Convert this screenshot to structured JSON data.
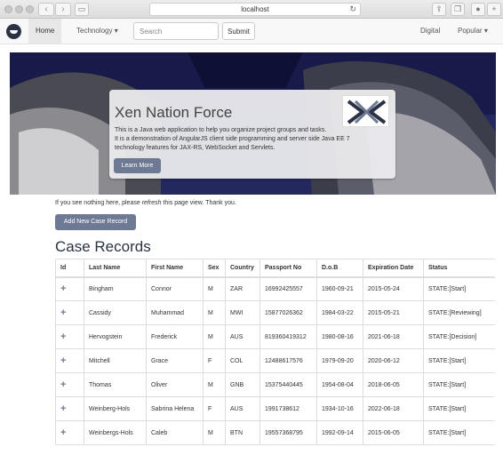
{
  "browser": {
    "url": "localhost"
  },
  "navbar": {
    "brand_icon": "owl-logo-icon",
    "home_label": "Home",
    "technology_label": "Technology",
    "search_placeholder": "Search",
    "submit_label": "Submit",
    "digital_label": "Digital",
    "popular_label": "Popular"
  },
  "hero": {
    "title": "Xen Nation Force",
    "line1": "This is a Java web application to help you organize project groups and tasks.",
    "line2": "It is a demonstration of AngularJS client side programming and server side Java EE 7",
    "line3": "technology features for JAX-RS, WebSocket and Servlets.",
    "learn_more_label": "Learn More",
    "logo_icon": "xen-x-logo-icon"
  },
  "notice": {
    "prefix": "If you see nothing here, please ",
    "emphasis": "refresh",
    "suffix": " this page view. Thank you."
  },
  "add_button_label": "Add New Case Record",
  "section_title": "Case Records",
  "table": {
    "columns": [
      "Id",
      "Last Name",
      "First Name",
      "Sex",
      "Country",
      "Passport No",
      "D.o.B",
      "Expiration Date",
      "Status"
    ],
    "rows": [
      [
        "+",
        "Bingham",
        "Connor",
        "M",
        "ZAR",
        "16992425557",
        "1960-09-21",
        "2015-05-24",
        "STATE:[Start]"
      ],
      [
        "+",
        "Cassidy",
        "Muhammad",
        "M",
        "MWI",
        "15877026362",
        "1984-03-22",
        "2015-05-21",
        "STATE:[Reviewing]"
      ],
      [
        "+",
        "Hervogstein",
        "Frederick",
        "M",
        "AUS",
        "819360419312",
        "1980-08-16",
        "2021-06-18",
        "STATE:[Decision]"
      ],
      [
        "+",
        "Mitchell",
        "Grace",
        "F",
        "COL",
        "12488617576",
        "1979-09-20",
        "2020-06-12",
        "STATE:[Start]"
      ],
      [
        "+",
        "Thomas",
        "Oliver",
        "M",
        "GNB",
        "15375440445",
        "1954-08-04",
        "2018-06-05",
        "STATE:[Start]"
      ],
      [
        "+",
        "Weinberg-Hols",
        "Sabrina Helena",
        "F",
        "AUS",
        "1991738612",
        "1934-10-16",
        "2022-06-18",
        "STATE:[Start]"
      ],
      [
        "+",
        "Weinbergs-Hols",
        "Caleb",
        "M",
        "BTN",
        "19557368795",
        "1992-09-14",
        "2015-06-05",
        "STATE:[Start]"
      ]
    ]
  },
  "colors": {
    "accent": "#6e7a93",
    "hero_navy": "#181a4a",
    "title": "#2a3244"
  }
}
